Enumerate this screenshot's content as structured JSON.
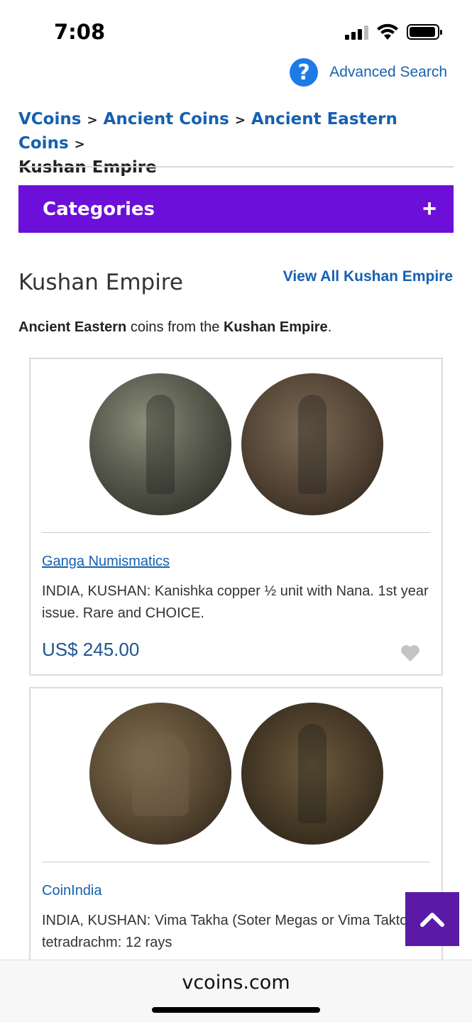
{
  "status_bar": {
    "time": "7:08"
  },
  "header": {
    "advanced_search": "Advanced Search",
    "help_icon": "?"
  },
  "breadcrumb": {
    "items": [
      "VCoins",
      "Ancient Coins",
      "Ancient Eastern Coins"
    ],
    "separator": ">",
    "current": "Kushan Empire"
  },
  "categories": {
    "label": "Categories",
    "toggle": "+"
  },
  "main": {
    "title": "Kushan Empire",
    "view_all": "View All Kushan Empire",
    "intro_bold_1": "Ancient Eastern",
    "intro_text_1": " coins from the ",
    "intro_bold_2": "Kushan Empire",
    "intro_text_2": "."
  },
  "listings": [
    {
      "dealer": "Ganga Numismatics",
      "description": "INDIA, KUSHAN: Kanishka copper ½ unit with Nana. 1st year issue. Rare and CHOICE.",
      "price": "US$ 245.00"
    },
    {
      "dealer": "CoinIndia",
      "description": "INDIA, KUSHAN: Vima Takha (Soter Megas or Vima Takto) AE tetradrachm: 12 rays"
    }
  ],
  "browser": {
    "url": "vcoins.com"
  },
  "colors": {
    "accent_purple": "#6c0fd9",
    "link_blue": "#1560b0",
    "price_blue": "#1d5690"
  }
}
